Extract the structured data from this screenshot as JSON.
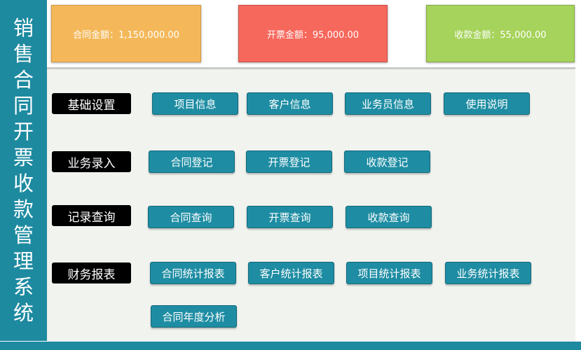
{
  "sidebar": {
    "title_chars": [
      "销",
      "售",
      "合",
      "同",
      "开",
      "票",
      "收",
      "款",
      "管",
      "理",
      "系",
      "统"
    ]
  },
  "summary": {
    "contract_amount": "合同金额：1,150,000.00",
    "invoice_amount": "开票金额：95,000.00",
    "receipt_amount": "收款金额：55,000.00"
  },
  "sections": {
    "basic": {
      "label": "基础设置",
      "buttons": [
        "项目信息",
        "客户信息",
        "业务员信息",
        "使用说明"
      ]
    },
    "entry": {
      "label": "业务录入",
      "buttons": [
        "合同登记",
        "开票登记",
        "收款登记"
      ]
    },
    "query": {
      "label": "记录查询",
      "buttons": [
        "合同查询",
        "开票查询",
        "收款查询"
      ]
    },
    "reports": {
      "label": "财务报表",
      "buttons": [
        "合同统计报表",
        "客户统计报表",
        "项目统计报表",
        "业务统计报表",
        "合同年度分析"
      ]
    }
  },
  "colors": {
    "sidebar": "#1d8aa0",
    "button": "#1e8da3",
    "card_contract": "#f4b85a",
    "card_invoice": "#f6675c",
    "card_receipt": "#a6d35b"
  }
}
